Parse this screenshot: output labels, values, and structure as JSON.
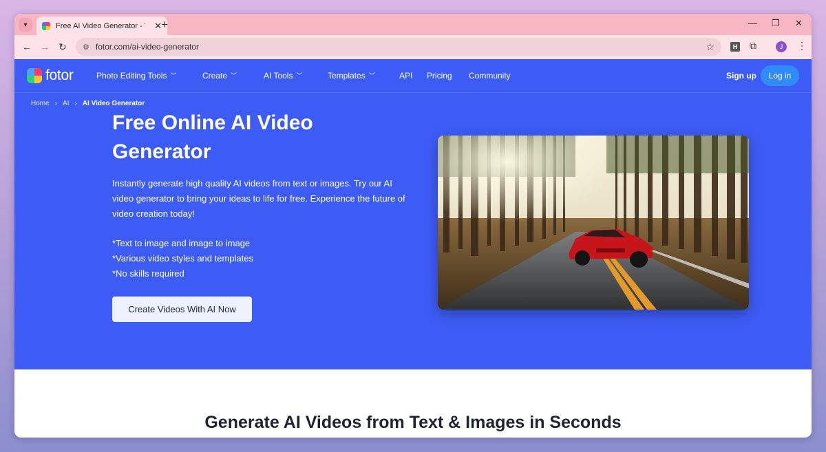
{
  "browser": {
    "tab_title": "Free AI Video Generator - Turn",
    "url": "fotor.com/ai-video-generator",
    "profile_initial": "J",
    "extension_label": "H"
  },
  "site": {
    "logo_text": "fotor",
    "nav": [
      {
        "label": "Photo Editing Tools",
        "dropdown": true
      },
      {
        "label": "Create",
        "dropdown": true
      },
      {
        "label": "AI Tools",
        "dropdown": true
      },
      {
        "label": "Templates",
        "dropdown": true
      },
      {
        "label": "API",
        "dropdown": false
      },
      {
        "label": "Pricing",
        "dropdown": false
      },
      {
        "label": "Community",
        "dropdown": false
      }
    ],
    "signup": "Sign up",
    "login": "Log in",
    "accent_color": "#3d5cf6",
    "login_color": "#2f8cf7"
  },
  "breadcrumb": [
    "Home",
    "AI",
    "AI Video Generator"
  ],
  "hero": {
    "title": "Free Online AI Video Generator",
    "description": "Instantly generate high quality AI videos from text or images. Try our AI video generator to bring your ideas to life for free. Experience the future of video creation today!",
    "features": [
      "*Text to image and image to image",
      "*Various video styles and templates",
      "*No skills required"
    ],
    "cta": "Create Videos With AI Now"
  },
  "section": {
    "title": "Generate AI Videos from Text & Images in Seconds"
  }
}
